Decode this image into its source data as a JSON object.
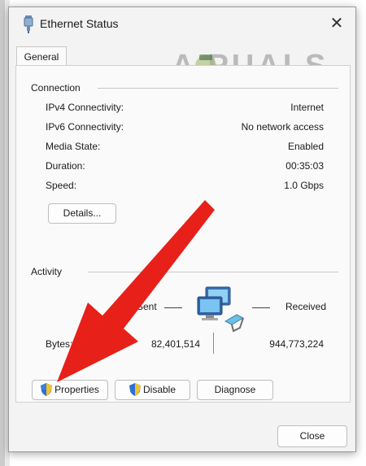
{
  "window": {
    "title": "Ethernet Status",
    "close_glyph": "✕"
  },
  "watermark": {
    "text": "A PUALS"
  },
  "tabs": [
    {
      "label": "General",
      "selected": true
    }
  ],
  "connection": {
    "heading": "Connection",
    "rows": [
      {
        "label": "IPv4 Connectivity:",
        "value": "Internet"
      },
      {
        "label": "IPv6 Connectivity:",
        "value": "No network access"
      },
      {
        "label": "Media State:",
        "value": "Enabled"
      },
      {
        "label": "Duration:",
        "value": "00:35:03"
      },
      {
        "label": "Speed:",
        "value": "1.0 Gbps"
      }
    ],
    "details_button": "Details..."
  },
  "activity": {
    "heading": "Activity",
    "sent_label": "Sent",
    "received_label": "Received",
    "bytes_label": "Bytes:",
    "bytes_sent": "82,401,514",
    "bytes_received": "944,773,224",
    "icon": "network-computers-icon"
  },
  "actions": {
    "properties": "Properties",
    "disable": "Disable",
    "diagnose": "Diagnose",
    "shield_icon": "uac-shield-icon"
  },
  "footer": {
    "close": "Close"
  },
  "colors": {
    "arrow": "#e8201a",
    "window_bg": "#f3f3f3",
    "panel_bg": "#fafafa"
  }
}
